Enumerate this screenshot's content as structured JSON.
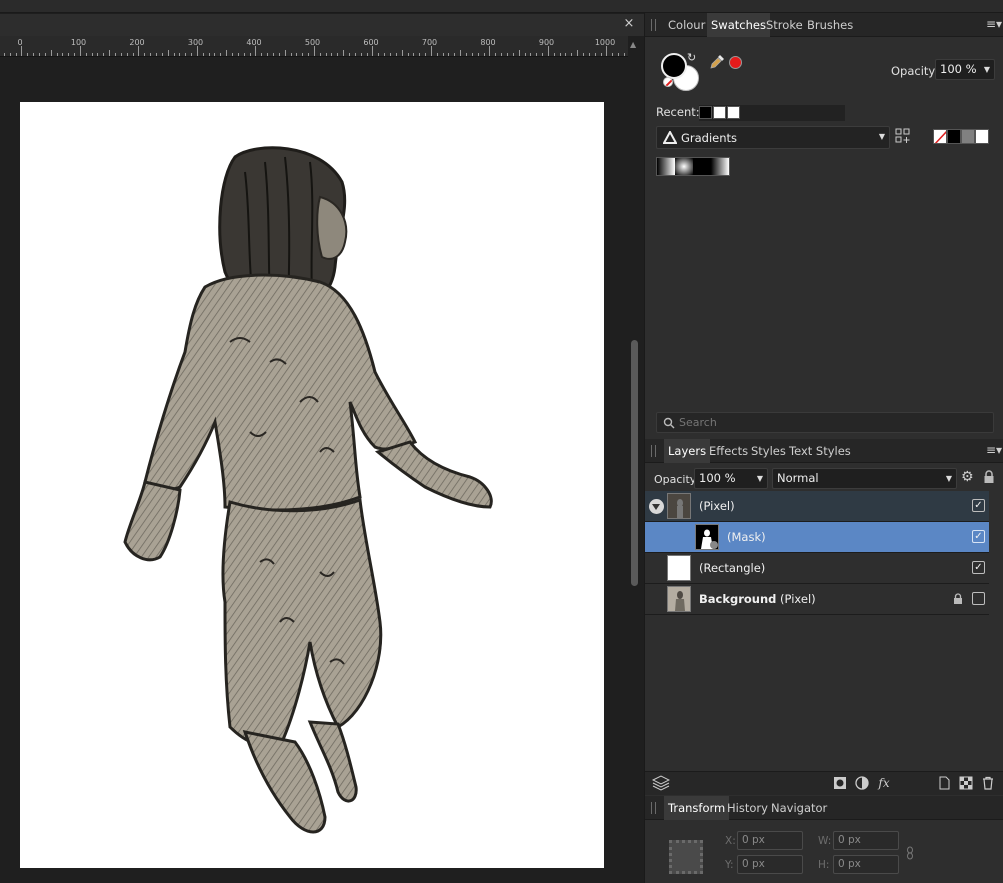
{
  "document": {
    "close_glyph": "×",
    "ruler_ticks": [
      "0",
      "100",
      "200",
      "300",
      "400",
      "500",
      "600",
      "700",
      "800",
      "900",
      "1000"
    ]
  },
  "swatches_panel": {
    "tabs": [
      {
        "label": "Colour",
        "active": false
      },
      {
        "label": "Swatches",
        "active": true
      },
      {
        "label": "Stroke",
        "active": false
      },
      {
        "label": "Brushes",
        "active": false
      }
    ],
    "opacity_label": "Opacity:",
    "opacity_value": "100 %",
    "recent_label": "Recent:",
    "recent_colors": [
      "#000000",
      "#ffffff",
      "#ffffff",
      "#ffffff"
    ],
    "palette_dropdown": "Gradients",
    "quick_colors": [
      "none",
      "#000000",
      "#808080",
      "#ffffff"
    ],
    "search_placeholder": "Search"
  },
  "layers_panel": {
    "tabs": [
      {
        "label": "Layers",
        "active": true
      },
      {
        "label": "Effects",
        "active": false
      },
      {
        "label": "Styles",
        "active": false
      },
      {
        "label": "Text Styles",
        "active": false
      }
    ],
    "opacity_label": "Opacity:",
    "opacity_value": "100 %",
    "blend_mode": "Normal",
    "layers": [
      {
        "name": "(Pixel)",
        "bold_prefix": "",
        "visible": true,
        "selected": "parent"
      },
      {
        "name": "(Mask)",
        "bold_prefix": "",
        "visible": true,
        "selected": "yes"
      },
      {
        "name": "(Rectangle)",
        "bold_prefix": "",
        "visible": true,
        "selected": "no"
      },
      {
        "name": " (Pixel)",
        "bold_prefix": "Background",
        "visible": false,
        "locked": true,
        "selected": "no"
      }
    ],
    "footer_icons": [
      "layers-stack-icon",
      "mask-icon",
      "adjustment-icon",
      "fx-icon",
      "new-doc-icon",
      "checker-icon",
      "trash-icon"
    ],
    "fx_glyph": "fx"
  },
  "transform_panel": {
    "tabs": [
      {
        "label": "Transform",
        "active": true
      },
      {
        "label": "History",
        "active": false
      },
      {
        "label": "Navigator",
        "active": false
      }
    ],
    "x_label": "X:",
    "x_value": "0 px",
    "y_label": "Y:",
    "y_value": "0 px",
    "w_label": "W:",
    "w_value": "0 px",
    "h_label": "H:",
    "h_value": "0 px"
  },
  "colors": {
    "panel_bg": "#2e2e2e",
    "selection": "#5b87c5",
    "accent_red": "#e51b1b"
  }
}
